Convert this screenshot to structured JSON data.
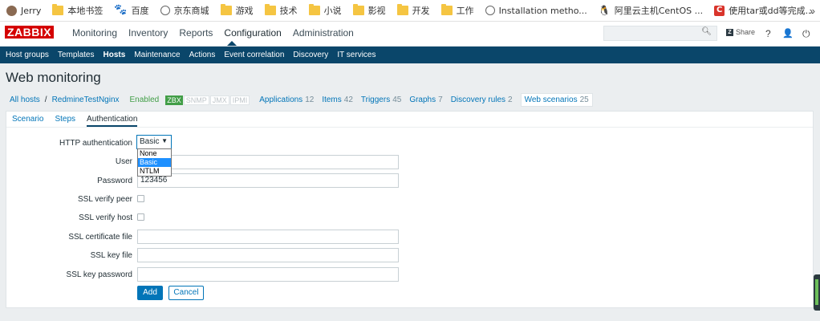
{
  "bookmarks": {
    "items": [
      {
        "label": "Jerry",
        "icon": "avatar-icon"
      },
      {
        "label": "本地书签",
        "icon": "folder-icon"
      },
      {
        "label": "百度",
        "icon": "paw-icon"
      },
      {
        "label": "京东商城",
        "icon": "globe-icon"
      },
      {
        "label": "游戏",
        "icon": "folder-icon"
      },
      {
        "label": "技术",
        "icon": "folder-icon"
      },
      {
        "label": "小说",
        "icon": "folder-icon"
      },
      {
        "label": "影视",
        "icon": "folder-icon"
      },
      {
        "label": "开发",
        "icon": "folder-icon"
      },
      {
        "label": "工作",
        "icon": "folder-icon"
      },
      {
        "label": "Installation metho...",
        "icon": "globe-icon"
      },
      {
        "label": "阿里云主机CentOS ...",
        "icon": "tux-icon"
      },
      {
        "label": "使用tar或dd等完成...",
        "icon": "c-icon"
      }
    ],
    "more": "»"
  },
  "header": {
    "logo": "ZABBIX",
    "nav": [
      "Monitoring",
      "Inventory",
      "Reports",
      "Configuration",
      "Administration"
    ],
    "active_nav": "Configuration",
    "search_placeholder": "",
    "share_label": "Share",
    "share_box": "Z",
    "help": "?",
    "user": "👤",
    "logout": "⏻"
  },
  "subnav": {
    "items": [
      "Host groups",
      "Templates",
      "Hosts",
      "Maintenance",
      "Actions",
      "Event correlation",
      "Discovery",
      "IT services"
    ],
    "active": "Hosts"
  },
  "page": {
    "title": "Web monitoring"
  },
  "breadcrumbs": {
    "all_hosts": "All hosts",
    "separator": "/",
    "host": "RedmineTestNginx",
    "status": "Enabled",
    "badges": [
      "ZBX",
      "SNMP",
      "JMX",
      "IPMI"
    ],
    "links": [
      {
        "label": "Applications",
        "count": "12"
      },
      {
        "label": "Items",
        "count": "42"
      },
      {
        "label": "Triggers",
        "count": "45"
      },
      {
        "label": "Graphs",
        "count": "7"
      },
      {
        "label": "Discovery rules",
        "count": "2"
      },
      {
        "label": "Web scenarios",
        "count": "25"
      }
    ]
  },
  "tabs": [
    {
      "label": "Scenario"
    },
    {
      "label": "Steps"
    },
    {
      "label": "Authentication"
    }
  ],
  "active_tab": "Authentication",
  "form": {
    "http_auth_label": "HTTP authentication",
    "http_auth_value": "Basic",
    "http_auth_options": [
      "None",
      "Basic",
      "NTLM"
    ],
    "user_label": "User",
    "user_value": "",
    "password_label": "Password",
    "password_value": "123456",
    "ssl_verify_peer_label": "SSL verify peer",
    "ssl_verify_host_label": "SSL verify host",
    "ssl_cert_label": "SSL certificate file",
    "ssl_cert_value": "",
    "ssl_key_label": "SSL key file",
    "ssl_key_value": "",
    "ssl_key_password_label": "SSL key password",
    "ssl_key_password_value": "",
    "add_button": "Add",
    "cancel_button": "Cancel"
  },
  "colors": {
    "accent": "#0275b8",
    "nav_bg": "#0a466a",
    "enabled_green": "#429e47",
    "logo_red": "#d40000"
  }
}
